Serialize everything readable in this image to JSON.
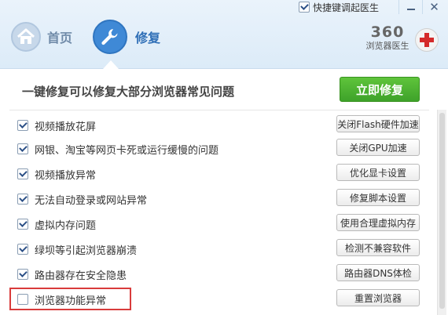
{
  "header": {
    "quick_launch_label": "快捷键调起医生",
    "quick_launch_checked": true,
    "nav": {
      "home_label": "首页",
      "repair_label": "修复"
    },
    "brand": {
      "number": "360",
      "subtitle": "浏览器医生"
    },
    "window": {
      "minimize_icon": "minimize-icon",
      "close_icon": "close-icon",
      "close_glyph": "✕"
    }
  },
  "main": {
    "banner_text": "一键修复可以修复大部分浏览器常见问题",
    "fix_all_label": "立即修复",
    "fix_all_color": "#4caf32",
    "issues": [
      {
        "label": "视频播放花屏",
        "checked": true,
        "action": "关闭Flash硬件加速"
      },
      {
        "label": "网银、淘宝等网页卡死或运行缓慢的问题",
        "checked": true,
        "action": "关闭GPU加速"
      },
      {
        "label": "视频播放异常",
        "checked": true,
        "action": "优化显卡设置"
      },
      {
        "label": "无法自动登录或网站异常",
        "checked": true,
        "action": "修复脚本设置"
      },
      {
        "label": "虚拟内存问题",
        "checked": true,
        "action": "使用合理虚拟内存"
      },
      {
        "label": "绿坝等引起浏览器崩溃",
        "checked": true,
        "action": "检测不兼容软件"
      },
      {
        "label": "路由器存在安全隐患",
        "checked": true,
        "action": "路由器DNS体检"
      },
      {
        "label": "浏览器功能异常",
        "checked": false,
        "action": "重置浏览器"
      }
    ]
  },
  "colors": {
    "accent_blue": "#3f89d6",
    "highlight_red": "#d93b3b",
    "brand_red": "#d42a2a"
  }
}
